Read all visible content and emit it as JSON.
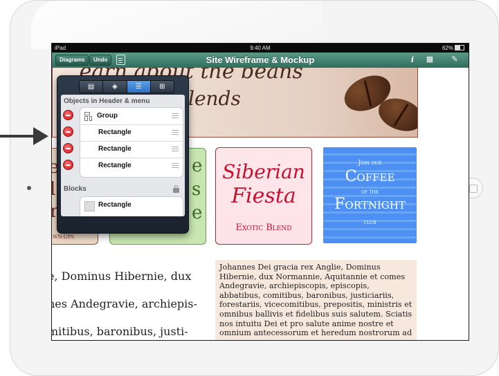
{
  "status_bar": {
    "device": "iPad",
    "time": "9:40 AM",
    "battery": "62%"
  },
  "navbar": {
    "diagrams_label": "Diagrams",
    "undo_label": "Undo",
    "title": "Site Wireframe & Mockup",
    "info_icon": "info-icon",
    "grid_icon": "grid-icon",
    "pencil_icon": "pencil-icon"
  },
  "banner": {
    "top_text": "...earn about the beans",
    "text": "lends"
  },
  "cards": {
    "green_partial": [
      "e",
      "s",
      "e"
    ],
    "brown_partial": [
      "e",
      "l",
      "r"
    ],
    "brown_small": "WN-UPS",
    "red": {
      "line1": "Siberian",
      "line2": "Fiesta",
      "line3": "Exotic Blend"
    },
    "blue": {
      "line1": "Join our",
      "line2": "Coffee",
      "line3": "of the",
      "line4": "Fortnight",
      "line5": "club"
    }
  },
  "body_lines": [
    "e, Dominus Hibernie, dux",
    "nes Andegravie, archiepis-",
    "mitibus, baronibus, justi-"
  ],
  "latin_box": "Johannes Dei gracia rex Anglie, Dominus Hibernie, dux Normannie, Aquitannie et comes Andegravie, archiepiscopis, episcopis, abbatibus, comitibus, baronibus, justiciariis, forestariis, vicecomitibus, prepositis, ministris et omnibus ballivis et fidelibus suis salutem. Sciatis nos intuitu Dei et pro salute anime nostre et omnium antecessorum et heredum nostrorum ad",
  "popover": {
    "segments": [
      "pages-icon",
      "layers-icon",
      "list-icon",
      "grid-view-icon"
    ],
    "active_segment": 2,
    "section_header": "Objects in Header & menu",
    "rows": [
      {
        "label": "Group"
      },
      {
        "label": "Rectangle"
      },
      {
        "label": "Rectangle"
      },
      {
        "label": "Rectangle"
      }
    ],
    "blocks_header": "Blocks",
    "block_row": "Rectangle"
  },
  "colors": {
    "nav_green": "#3d7f6c",
    "red_brand": "#c8102e",
    "blue_card": "#4d8ff2"
  }
}
